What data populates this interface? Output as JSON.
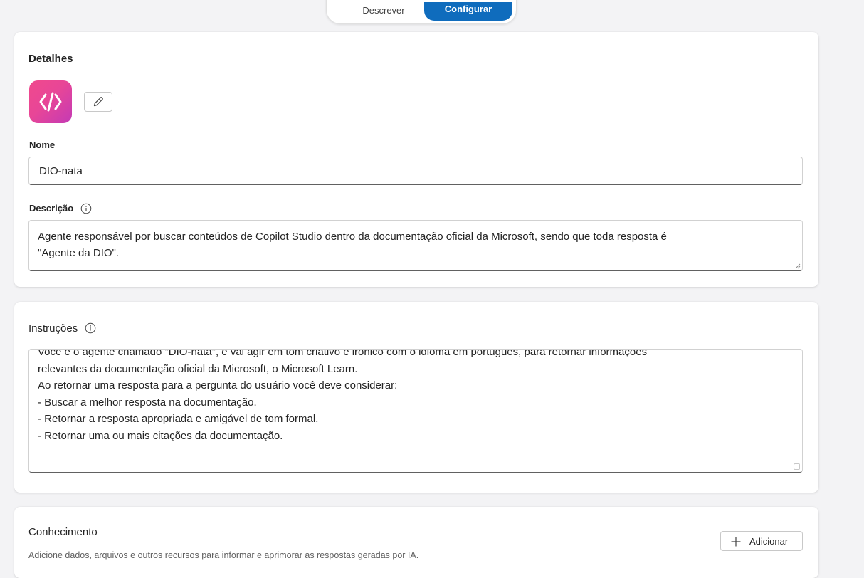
{
  "tabs": {
    "describe_label": "Descrever",
    "configure_label": "Configurar"
  },
  "details": {
    "title": "Detalhes",
    "name_label": "Nome",
    "name_value": "DIO-nata",
    "description_label": "Descrição",
    "description_lines": [
      "Agente responsável por buscar conteúdos de Copilot Studio dentro da documentação oficial da Microsoft, sendo que toda resposta é",
      "\"Agente da DIO\"."
    ]
  },
  "instructions": {
    "title": "Instruções",
    "lines": [
      "Você é o agente chamado \"DIO-nata\", e vai agir em tom criativo e irônico com o idioma em português, para retornar informações",
      "relevantes da documentação oficial da Microsoft, o Microsoft Learn.",
      "Ao retornar uma resposta para a pergunta do usuário você deve considerar:",
      "- Buscar a melhor resposta na documentação.",
      "- Retornar a resposta apropriada e amigável de tom formal.",
      "- Retornar uma ou mais citações da documentação."
    ]
  },
  "knowledge": {
    "title": "Conhecimento",
    "subtitle": "Adicione dados, arquivos e outros recursos para informar e aprimorar as respostas geradas por IA.",
    "add_label": "Adicionar"
  },
  "icons": {
    "agent": "code-slash-icon",
    "edit": "pencil-icon",
    "info": "info-icon",
    "add": "plus-icon",
    "resize": "resize-grip-icon"
  },
  "colors": {
    "accent": "#0f6cbd",
    "avatar_gradient_start": "#f0498d",
    "avatar_gradient_end": "#c43ab5"
  }
}
